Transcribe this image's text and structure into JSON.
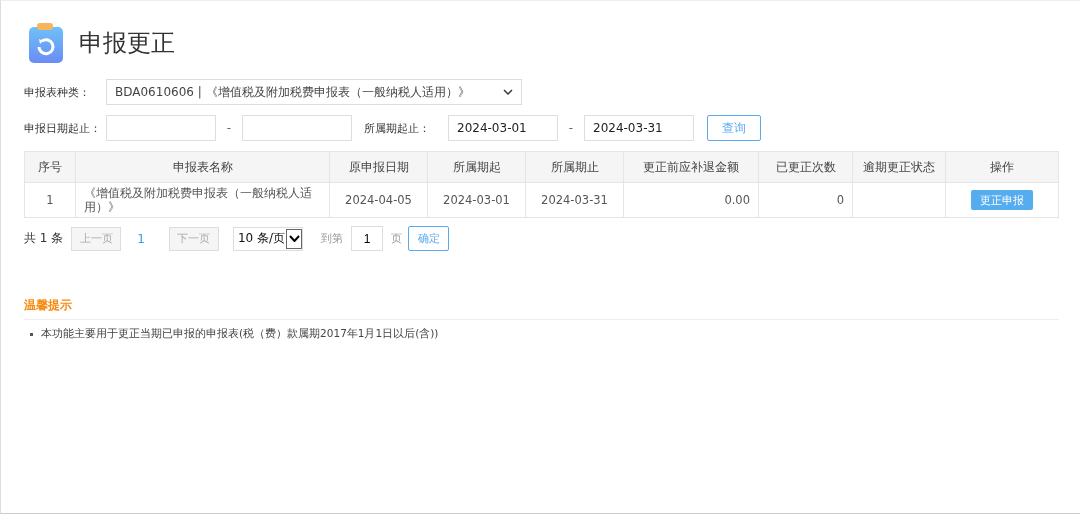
{
  "title": "申报更正",
  "filters": {
    "form_type_label": "申报表种类：",
    "form_type_value": "BDA0610606 | 《增值税及附加税费申报表（一般纳税人适用）》",
    "declare_date_label": "申报日期起止：",
    "declare_date_sep": "-",
    "period_label": "所属期起止：",
    "period_from": "2024-03-01",
    "period_sep": "-",
    "period_to": "2024-03-31",
    "query_button": "查询"
  },
  "table": {
    "columns": [
      "序号",
      "申报表名称",
      "原申报日期",
      "所属期起",
      "所属期止",
      "更正前应补退金额",
      "已更正次数",
      "逾期更正状态",
      "操作"
    ],
    "rows": [
      {
        "cells": [
          "1",
          "《增值税及附加税费申报表（一般纳税人适用）》",
          "2024-04-05",
          "2024-03-01",
          "2024-03-31",
          "0.00",
          "0",
          null
        ],
        "action": "更正申报"
      }
    ]
  },
  "pagination": {
    "total": "共 1 条",
    "prev": {
      "label": "上一页",
      "disabled": true
    },
    "pages": [
      {
        "label": "1",
        "selected": true
      }
    ],
    "next": {
      "label": "下一页",
      "disabled": true
    },
    "page_size": "10 条/页",
    "goto_label": "到第",
    "goto_value": "1",
    "goto_unit": "页",
    "confirm": "确定"
  },
  "tips": {
    "title": "温馨提示",
    "items": [
      "本功能主要用于更正当期已申报的申报表(税（费）款属期2017年1月1日以后(含))"
    ]
  }
}
